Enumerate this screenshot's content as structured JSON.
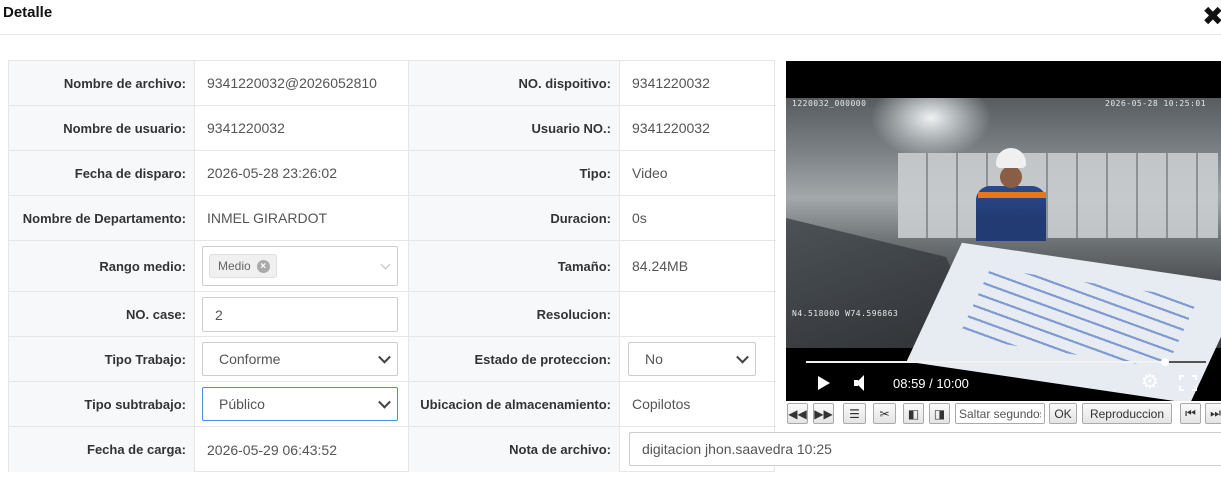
{
  "header": {
    "title": "Detalle",
    "close_icon": "close-icon"
  },
  "fields": {
    "nombre_archivo": {
      "label": "Nombre de archivo:",
      "value": "9341220032@2026052810"
    },
    "no_dispositivo": {
      "label": "NO. dispoitivo:",
      "value": "9341220032"
    },
    "nombre_usuario": {
      "label": "Nombre de usuario:",
      "value": "9341220032"
    },
    "usuario_no": {
      "label": "Usuario NO.:",
      "value": "9341220032"
    },
    "fecha_disparo": {
      "label": "Fecha de disparo:",
      "value": "2026-05-28 23:26:02"
    },
    "tipo": {
      "label": "Tipo:",
      "value": "Video"
    },
    "departamento": {
      "label": "Nombre de Departamento:",
      "value": "INMEL GIRARDOT"
    },
    "duracion": {
      "label": "Duracion:",
      "value": "0s"
    },
    "rango_medio": {
      "label": "Rango medio:",
      "tag": "Medio"
    },
    "tamano": {
      "label": "Tamaño:",
      "value": "84.24MB"
    },
    "no_case": {
      "label": "NO. case:",
      "value": "2"
    },
    "resolucion": {
      "label": "Resolucion:",
      "value": ""
    },
    "tipo_trabajo": {
      "label": "Tipo Trabajo:",
      "value": "Conforme"
    },
    "estado_proteccion": {
      "label": "Estado de proteccion:",
      "value": "No"
    },
    "tipo_subtrabajo": {
      "label": "Tipo subtrabajo:",
      "value": "Público"
    },
    "ubicacion": {
      "label": "Ubicacion de almacenamiento:",
      "value": "Copilotos"
    },
    "fecha_carga": {
      "label": "Fecha de carga:",
      "value": "2026-05-29 06:43:52"
    },
    "nota": {
      "label": "Nota de archivo:",
      "value": "digitacion jhon.saavedra 10:25"
    }
  },
  "video": {
    "osd_top_left": "1220032_000000",
    "osd_top_right": "2026-05-28 10:25:01",
    "osd_bottom_left": "N4.518000 W74.596863",
    "time": "08:59 / 10:00",
    "progress": 0.898
  },
  "toolbar": {
    "prev_frame": "◀◀",
    "next_frame": "▶▶",
    "list": "☰",
    "cut": "✂",
    "step_back": "◧",
    "step_fwd": "◨",
    "jump_placeholder": "Saltar segundos",
    "ok": "OK",
    "playback": "Reproduccion",
    "first": "⏮",
    "last": "⏭"
  }
}
